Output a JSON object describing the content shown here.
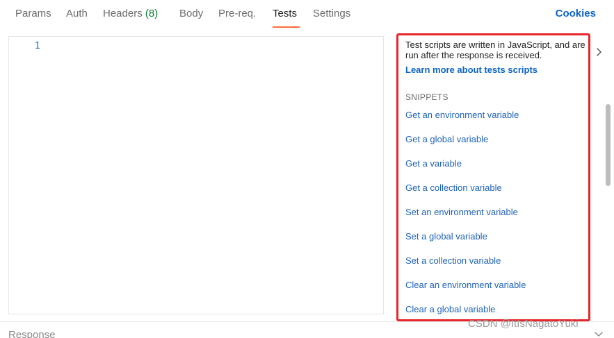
{
  "tabs": [
    {
      "label": "Params"
    },
    {
      "label": "Auth"
    },
    {
      "label": "Headers",
      "count": "(8)"
    },
    {
      "label": "Body"
    },
    {
      "label": "Pre-req."
    },
    {
      "label": "Tests",
      "active": true
    },
    {
      "label": "Settings"
    }
  ],
  "cookies_label": "Cookies",
  "editor": {
    "line_number": "1"
  },
  "panel": {
    "description": "Test scripts are written in JavaScript, and are run after the response is received.",
    "learn_more": "Learn more about tests scripts",
    "snippets_title": "SNIPPETS",
    "snippets": [
      "Get an environment variable",
      "Get a global variable",
      "Get a variable",
      "Get a collection variable",
      "Set an environment variable",
      "Set a global variable",
      "Set a collection variable",
      "Clear an environment variable",
      "Clear a global variable"
    ]
  },
  "response_label": "Response",
  "watermark": "CSDN @ItIsNagatoYuki",
  "colors": {
    "accent_link": "#0b64c4",
    "active_tab_underline": "#ff6c37",
    "highlight_box": "#e8252a",
    "count_green": "#0d7d3a"
  },
  "icons": {
    "panel_toggle": "chevron-right-icon",
    "response_toggle": "chevron-down-icon"
  }
}
